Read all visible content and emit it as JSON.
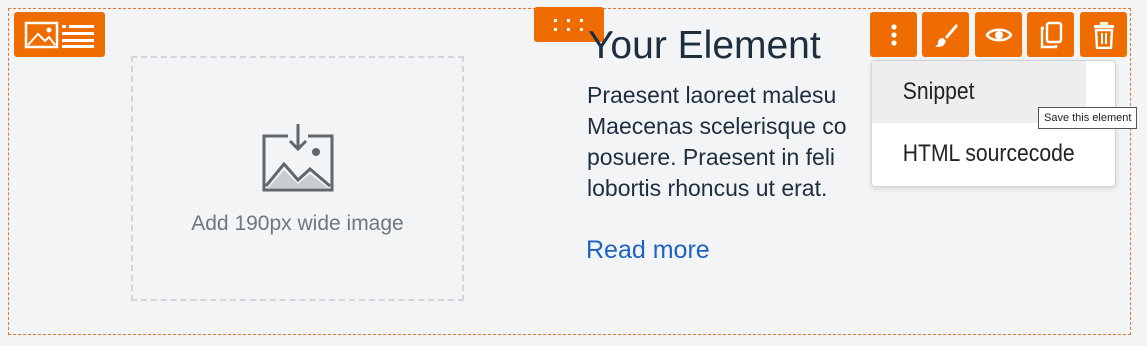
{
  "element": {
    "title": "Your Element",
    "body_lines": [
      "Praesent laoreet malesu",
      "Maecenas scelerisque co",
      "posuere. Praesent in feli",
      "lobortis rhoncus ut erat."
    ],
    "read_more": "Read more"
  },
  "image_placeholder": {
    "label": "Add 190px wide image",
    "icon": "image-download-icon"
  },
  "toolbar": {
    "layout_icon": "image-text-layout-icon",
    "drag_icon": "drag-handle-icon",
    "buttons": [
      {
        "icon": "more-vertical-icon"
      },
      {
        "icon": "paintbrush-icon"
      },
      {
        "icon": "eye-icon"
      },
      {
        "icon": "copy-icon"
      },
      {
        "icon": "trash-icon"
      }
    ]
  },
  "menu": {
    "items": [
      "Snippet",
      "HTML sourcecode"
    ]
  },
  "tooltip": "Save this element",
  "colors": {
    "accent": "#ef6c00",
    "link": "#1f63c2",
    "text": "#1d2e3f"
  }
}
